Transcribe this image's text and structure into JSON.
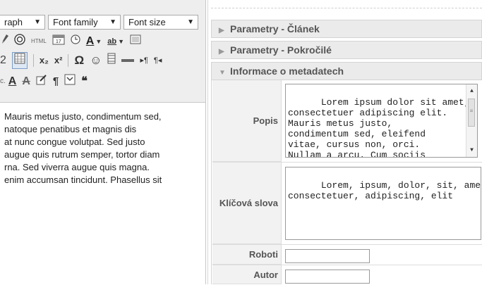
{
  "editor": {
    "toolbar": {
      "paragraph_select": "raph",
      "font_family_select": "Font family",
      "font_size_select": "Font size",
      "dropdown_arrow": "▼",
      "row1": {
        "html_label": "HTML",
        "font_color": "A",
        "highlight": "ab"
      },
      "row2": {
        "subscript": "x₂",
        "superscript": "x²",
        "omega": "Ω",
        "smiley": "☺",
        "ltr": "▸¶",
        "rtl": "¶◂"
      },
      "row3": {
        "small_c": "c.",
        "a_underline": "A",
        "a_strike": "A",
        "pilcrow": "¶",
        "quote": "❝"
      }
    },
    "content_lines": [
      "Mauris metus justo, condimentum sed,",
      "natoque penatibus et magnis dis",
      "at nunc congue volutpat. Sed justo",
      "augue quis rutrum semper, tortor diam",
      "rna. Sed viverra augue quis magna.",
      "enim accumsan tincidunt. Phasellus sit"
    ]
  },
  "panel": {
    "sections": [
      {
        "label": "Parametry - Článek",
        "expanded": false,
        "arrow": "▶"
      },
      {
        "label": "Parametry - Pokročilé",
        "expanded": false,
        "arrow": "▶"
      },
      {
        "label": "Informace o metadatech",
        "expanded": true,
        "arrow": "▼"
      }
    ],
    "fields": {
      "popis": {
        "label": "Popis",
        "value": "Lorem ipsum dolor sit amet,\nconsectetuer adipiscing elit.\nMauris metus justo,\ncondimentum sed, eleifend\nvitae, cursus non, orci.\nNullam a arcu. Cum sociis"
      },
      "klicova_slova": {
        "label": "Klíčová slova",
        "value": "Lorem, ipsum, dolor, sit, amet,\nconsectetuer, adipiscing, elit"
      },
      "roboti": {
        "label": "Roboti",
        "value": ""
      },
      "autor": {
        "label": "Autor",
        "value": ""
      }
    },
    "scroll": {
      "up": "▲",
      "down": "▼",
      "grip": "≡"
    }
  }
}
